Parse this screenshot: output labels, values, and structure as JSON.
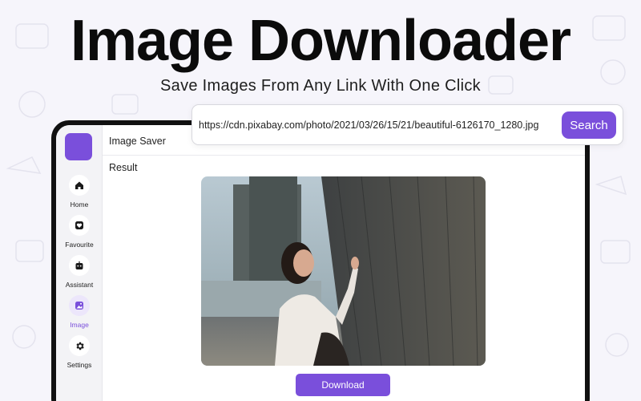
{
  "hero": {
    "title": "Image Downloader",
    "subtitle": "Save Images From Any Link With One Click"
  },
  "search": {
    "url_value": "https://cdn.pixabay.com/photo/2021/03/26/15/21/beautiful-6126170_1280.jpg",
    "button_label": "Search"
  },
  "app": {
    "title": "Image Saver",
    "result_label": "Result",
    "download_label": "Download"
  },
  "sidebar": {
    "items": [
      {
        "label": "Home",
        "icon": "home-icon"
      },
      {
        "label": "Favourite",
        "icon": "heart-icon"
      },
      {
        "label": "Assistant",
        "icon": "robot-icon"
      },
      {
        "label": "Image",
        "icon": "image-icon",
        "active": true
      },
      {
        "label": "Settings",
        "icon": "gear-icon"
      }
    ]
  },
  "colors": {
    "accent": "#7a4fdb",
    "background": "#f6f5fb",
    "device_frame": "#111111"
  }
}
